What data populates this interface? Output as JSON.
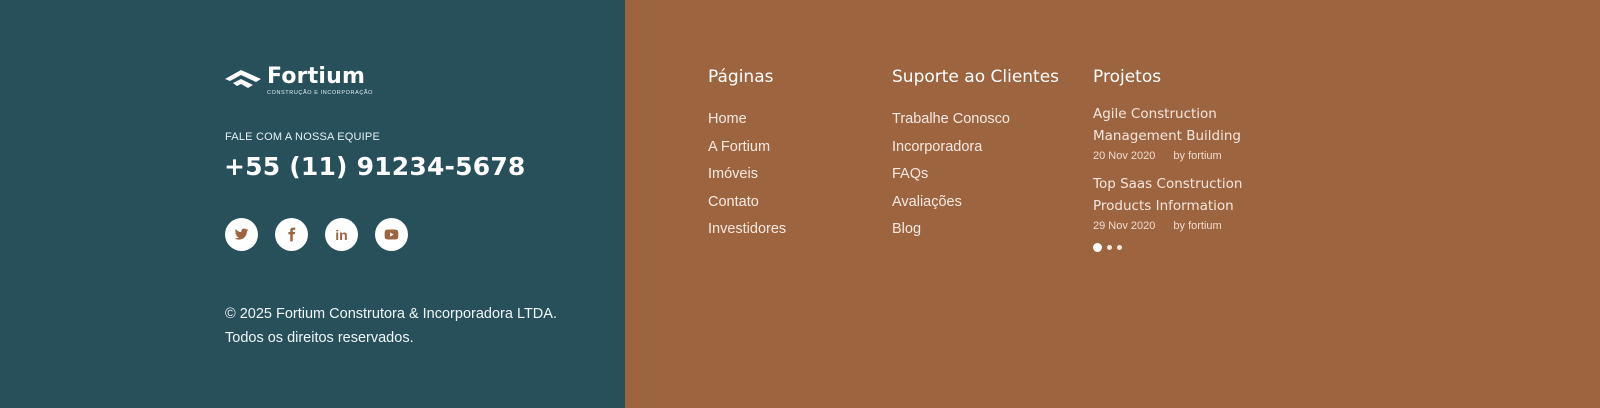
{
  "brand": {
    "name": "Fortium",
    "tagline": "CONSTRUÇÃO E INCORPORAÇÃO",
    "left_bg": "#27505b",
    "right_bg": "#9d6440"
  },
  "contact": {
    "label": "FALE COM A NOSSA EQUIPE",
    "phone": "+55 (11) 91234-5678"
  },
  "socials": [
    {
      "icon": "twitter-icon"
    },
    {
      "icon": "facebook-icon"
    },
    {
      "icon": "linkedin-icon",
      "text": "in"
    },
    {
      "icon": "youtube-icon"
    }
  ],
  "copyright": {
    "line1": "© 2025 Fortium Construtora & Incorporadora LTDA.",
    "line2": "Todos os direitos reservados."
  },
  "pages": {
    "title": "Páginas",
    "links": [
      "Home",
      "A Fortium",
      "Imóveis",
      "Contato",
      "Investidores"
    ]
  },
  "support": {
    "title": "Suporte ao Clientes",
    "links": [
      "Trabalhe Conosco",
      "Incorporadora",
      "FAQs",
      "Avaliações",
      "Blog"
    ]
  },
  "projects": {
    "title": "Projetos",
    "posts": [
      {
        "title_line1": "Agile Construction",
        "title_line2": "Management Building",
        "date": "20 Nov 2020",
        "author": "by fortium"
      },
      {
        "title_line1": "Top Saas Construction",
        "title_line2": "Products Information",
        "date": "29 Nov 2020",
        "author": "by fortium"
      }
    ],
    "slider_active": 1,
    "slider_total": 3
  }
}
